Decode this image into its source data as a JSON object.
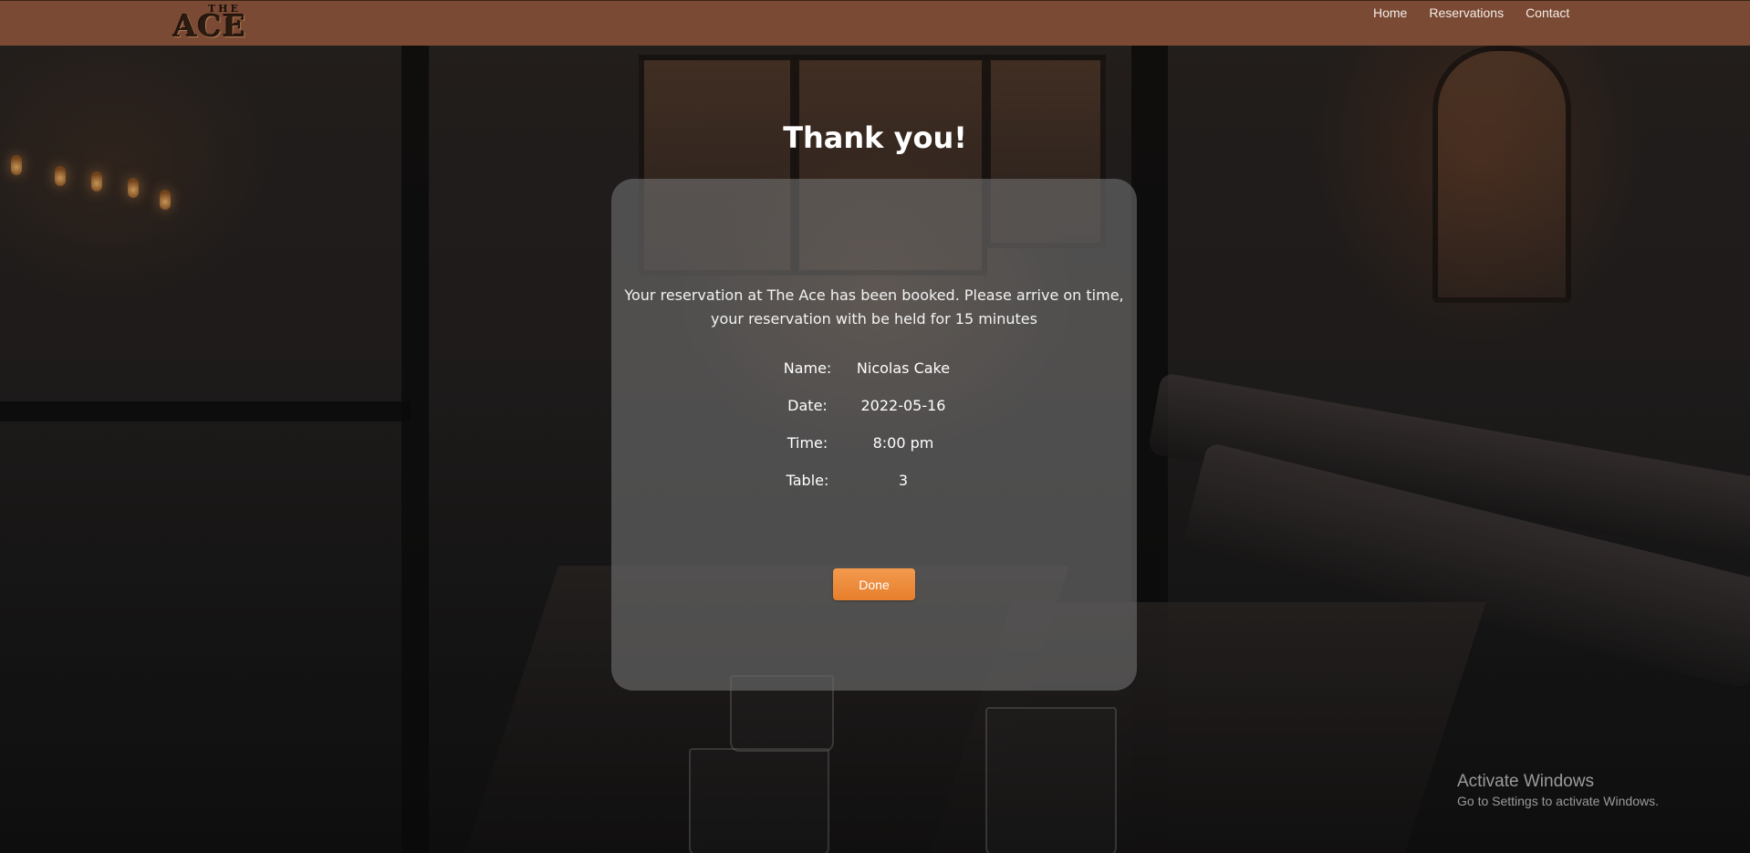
{
  "navbar": {
    "logo_top": "THE",
    "logo_main": "ACE",
    "links": [
      {
        "label": "Home"
      },
      {
        "label": "Reservations"
      },
      {
        "label": "Contact"
      }
    ]
  },
  "main": {
    "title": "Thank you!",
    "message_line1": "Your reservation at The Ace has been booked. Please arrive on time,",
    "message_line2": "your reservation with be held for 15 minutes",
    "details": [
      {
        "label": "Name:",
        "value": "Nicolas Cake"
      },
      {
        "label": "Date:",
        "value": "2022-05-16"
      },
      {
        "label": "Time:",
        "value": "8:00 pm"
      },
      {
        "label": "Table:",
        "value": "3"
      }
    ],
    "done_label": "Done"
  },
  "watermark": {
    "title": "Activate Windows",
    "subtitle": "Go to Settings to activate Windows."
  },
  "colors": {
    "navbar": "#7a4a34",
    "accent_button": "#e88630",
    "card": "#707070"
  }
}
